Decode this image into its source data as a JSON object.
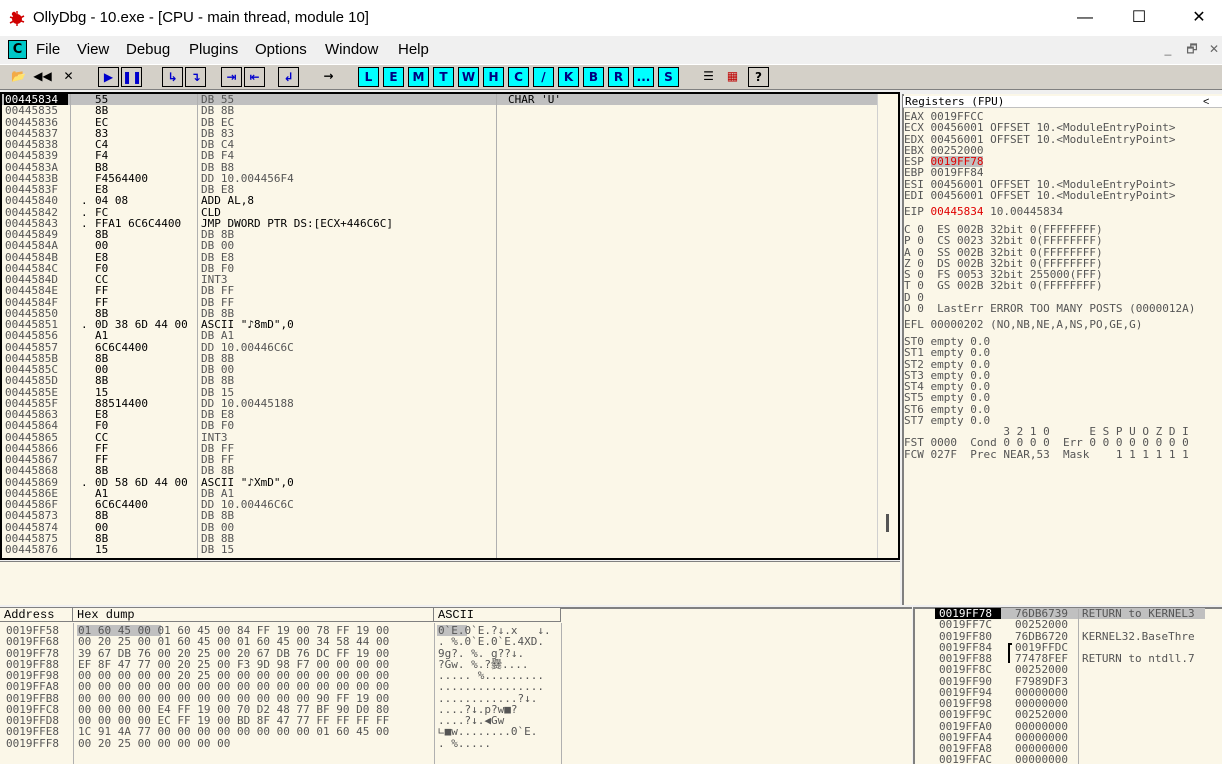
{
  "window": {
    "title": "OllyDbg - 10.exe - [CPU - main thread, module 10]",
    "minimize": "—",
    "maximize": "☐",
    "close": "✕"
  },
  "menu": {
    "app_icon": "C",
    "items": [
      "File",
      "View",
      "Debug",
      "Plugins",
      "Options",
      "Window",
      "Help"
    ],
    "mdi": [
      "_",
      "🗗",
      "✕"
    ]
  },
  "toolbar": {
    "file_buttons": [
      "📂",
      "◀◀",
      "✕"
    ],
    "run_buttons": [
      "▶",
      "❚❚"
    ],
    "step_buttons": [
      "↳",
      "↴",
      "⇥",
      "⇤",
      "↲",
      "→"
    ],
    "letter_buttons": [
      "L",
      "E",
      "M",
      "T",
      "W",
      "H",
      "C",
      "/",
      "K",
      "B",
      "R",
      "...",
      "S"
    ],
    "end_buttons": [
      "☰",
      "▦",
      "?"
    ]
  },
  "disasm": {
    "addresses": [
      "00445834",
      "00445835",
      "00445836",
      "00445837",
      "00445838",
      "00445839",
      "0044583A",
      "0044583B",
      "0044583F",
      "00445840",
      "00445842",
      "00445843",
      "00445849",
      "0044584A",
      "0044584B",
      "0044584C",
      "0044584D",
      "0044584E",
      "0044584F",
      "00445850",
      "00445851",
      "00445856",
      "00445857",
      "0044585B",
      "0044585C",
      "0044585D",
      "0044585E",
      "0044585F",
      "00445863",
      "00445864",
      "00445865",
      "00445866",
      "00445867",
      "00445868",
      "00445869",
      "0044586E",
      "0044586F",
      "00445873",
      "00445874",
      "00445875",
      "00445876"
    ],
    "hex": [
      "55",
      "8B",
      "EC",
      "83",
      "C4",
      "F4",
      "B8",
      "F4564400",
      "E8",
      "04 08",
      "FC",
      "FFA1 6C6C4400",
      "8B",
      "00",
      "E8",
      "F0",
      "CC",
      "FF",
      "FF",
      "8B",
      "0D 38 6D 44 00",
      "A1",
      "6C6C4400",
      "8B",
      "00",
      "8B",
      "15",
      "88514400",
      "E8",
      "F0",
      "CC",
      "FF",
      "FF",
      "8B",
      "0D 58 6D 44 00",
      "A1",
      "6C6C4400",
      "8B",
      "00",
      "8B",
      "15"
    ],
    "markers": [
      "",
      "",
      "",
      "",
      "",
      "",
      "",
      "",
      "",
      ".",
      ".",
      ".",
      "",
      "",
      "",
      "",
      "",
      "",
      "",
      "",
      ".",
      "",
      "",
      "",
      "",
      "",
      "",
      "",
      "",
      "",
      "",
      "",
      "",
      "",
      ".",
      "",
      "",
      "",
      "",
      "",
      ""
    ],
    "instructions": [
      "DB 55",
      "DB 8B",
      "DB EC",
      "DB 83",
      "DB C4",
      "DB F4",
      "DB B8",
      "DD 10.004456F4",
      "DB E8",
      "ADD AL,8",
      "CLD",
      "JMP DWORD PTR DS:[ECX+446C6C]",
      "DB 8B",
      "DB 00",
      "DB E8",
      "DB F0",
      "INT3",
      "DB FF",
      "DB FF",
      "DB 8B",
      "ASCII \"♪8mD\",0",
      "DB A1",
      "DD 10.00446C6C",
      "DB 8B",
      "DB 00",
      "DB 8B",
      "DB 15",
      "DD 10.00445188",
      "DB E8",
      "DB F0",
      "INT3",
      "DB FF",
      "DB FF",
      "DB 8B",
      "ASCII \"♪XmD\",0",
      "DB A1",
      "DD 10.00446C6C",
      "DB 8B",
      "DB 00",
      "DB 8B",
      "DB 15"
    ],
    "dark_instructions": [
      9,
      10,
      11,
      20,
      34
    ],
    "comments": [
      "CHAR 'U'"
    ]
  },
  "registers": {
    "header": "Registers (FPU)",
    "collapse": "<",
    "gp": [
      {
        "name": "EAX",
        "value": "0019FFCC",
        "note": ""
      },
      {
        "name": "ECX",
        "value": "00456001",
        "note": "OFFSET 10.<ModuleEntryPoint>"
      },
      {
        "name": "EDX",
        "value": "00456001",
        "note": "OFFSET 10.<ModuleEntryPoint>"
      },
      {
        "name": "EBX",
        "value": "00252000",
        "note": ""
      },
      {
        "name": "ESP",
        "value": "0019FF78",
        "note": ""
      },
      {
        "name": "EBP",
        "value": "0019FF84",
        "note": ""
      },
      {
        "name": "ESI",
        "value": "00456001",
        "note": "OFFSET 10.<ModuleEntryPoint>"
      },
      {
        "name": "EDI",
        "value": "00456001",
        "note": "OFFSET 10.<ModuleEntryPoint>"
      }
    ],
    "eip": {
      "name": "EIP",
      "value": "00445834",
      "note": "10.00445834"
    },
    "flags": [
      "C 0  ES 002B 32bit 0(FFFFFFFF)",
      "P 0  CS 0023 32bit 0(FFFFFFFF)",
      "A 0  SS 002B 32bit 0(FFFFFFFF)",
      "Z 0  DS 002B 32bit 0(FFFFFFFF)",
      "S 0  FS 0053 32bit 255000(FFF)",
      "T 0  GS 002B 32bit 0(FFFFFFFF)",
      "D 0",
      "O 0  LastErr ERROR_TOO_MANY_POSTS (0000012A)"
    ],
    "efl": "EFL 00000202 (NO,NB,NE,A,NS,PO,GE,G)",
    "fpu": [
      "ST0 empty 0.0",
      "ST1 empty 0.0",
      "ST2 empty 0.0",
      "ST3 empty 0.0",
      "ST4 empty 0.0",
      "ST5 empty 0.0",
      "ST6 empty 0.0",
      "ST7 empty 0.0"
    ],
    "fpu_tail": [
      "               3 2 1 0      E S P U O Z D I",
      "FST 0000  Cond 0 0 0 0  Err 0 0 0 0 0 0 0 0",
      "FCW 027F  Prec NEAR,53  Mask    1 1 1 1 1 1"
    ]
  },
  "dump": {
    "headers": {
      "address": "Address",
      "hex": "Hex dump",
      "ascii": "ASCII"
    },
    "rows": [
      {
        "addr": "0019FF58",
        "hex": "01 60 45 00 01 60 45 00 84 FF 19 00 78 FF 19 00",
        "ascii": "0`E.0`E.?↓.x   ↓."
      },
      {
        "addr": "0019FF68",
        "hex": "00 20 25 00 01 60 45 00 01 60 45 00 34 58 44 00",
        "ascii": ". %.0`E.0`E.4XD."
      },
      {
        "addr": "0019FF78",
        "hex": "39 67 DB 76 00 20 25 00 20 67 DB 76 DC FF 19 00",
        "ascii": "9g?. %. g??↓."
      },
      {
        "addr": "0019FF88",
        "hex": "EF 8F 47 77 00 20 25 00 F3 9D 98 F7 00 00 00 00",
        "ascii": "?Gw. %.?爨...."
      },
      {
        "addr": "0019FF98",
        "hex": "00 00 00 00 00 20 25 00 00 00 00 00 00 00 00 00",
        "ascii": "..... %........."
      },
      {
        "addr": "0019FFA8",
        "hex": "00 00 00 00 00 00 00 00 00 00 00 00 00 00 00 00",
        "ascii": "................"
      },
      {
        "addr": "0019FFB8",
        "hex": "00 00 00 00 00 00 00 00 00 00 00 00 90 FF 19 00",
        "ascii": "............?↓."
      },
      {
        "addr": "0019FFC8",
        "hex": "00 00 00 00 E4 FF 19 00 70 D2 48 77 BF 90 D0 80",
        "ascii": "....?↓.p?w■?"
      },
      {
        "addr": "0019FFD8",
        "hex": "00 00 00 00 EC FF 19 00 BD 8F 47 77 FF FF FF FF",
        "ascii": "....?↓.◀Gw"
      },
      {
        "addr": "0019FFE8",
        "hex": "1C 91 4A 77 00 00 00 00 00 00 00 00 01 60 45 00",
        "ascii": "∟■w........0`E."
      },
      {
        "addr": "0019FFF8",
        "hex": "00 20 25 00 00 00 00 00",
        "ascii": ". %....."
      }
    ]
  },
  "stack": {
    "rows": [
      {
        "addr": "0019FF78",
        "value": "76DB6739",
        "note": "RETURN to KERNEL3"
      },
      {
        "addr": "0019FF7C",
        "value": "00252000",
        "note": ""
      },
      {
        "addr": "0019FF80",
        "value": "76DB6720",
        "note": "KERNEL32.BaseThre"
      },
      {
        "addr": "0019FF84",
        "value": "0019FFDC",
        "note": ""
      },
      {
        "addr": "0019FF88",
        "value": "77478FEF",
        "note": "RETURN to ntdll.7"
      },
      {
        "addr": "0019FF8C",
        "value": "00252000",
        "note": ""
      },
      {
        "addr": "0019FF90",
        "value": "F7989DF3",
        "note": ""
      },
      {
        "addr": "0019FF94",
        "value": "00000000",
        "note": ""
      },
      {
        "addr": "0019FF98",
        "value": "00000000",
        "note": ""
      },
      {
        "addr": "0019FF9C",
        "value": "00252000",
        "note": ""
      },
      {
        "addr": "0019FFA0",
        "value": "00000000",
        "note": ""
      },
      {
        "addr": "0019FFA4",
        "value": "00000000",
        "note": ""
      },
      {
        "addr": "0019FFA8",
        "value": "00000000",
        "note": ""
      },
      {
        "addr": "0019FFAC",
        "value": "00000000",
        "note": ""
      }
    ]
  }
}
